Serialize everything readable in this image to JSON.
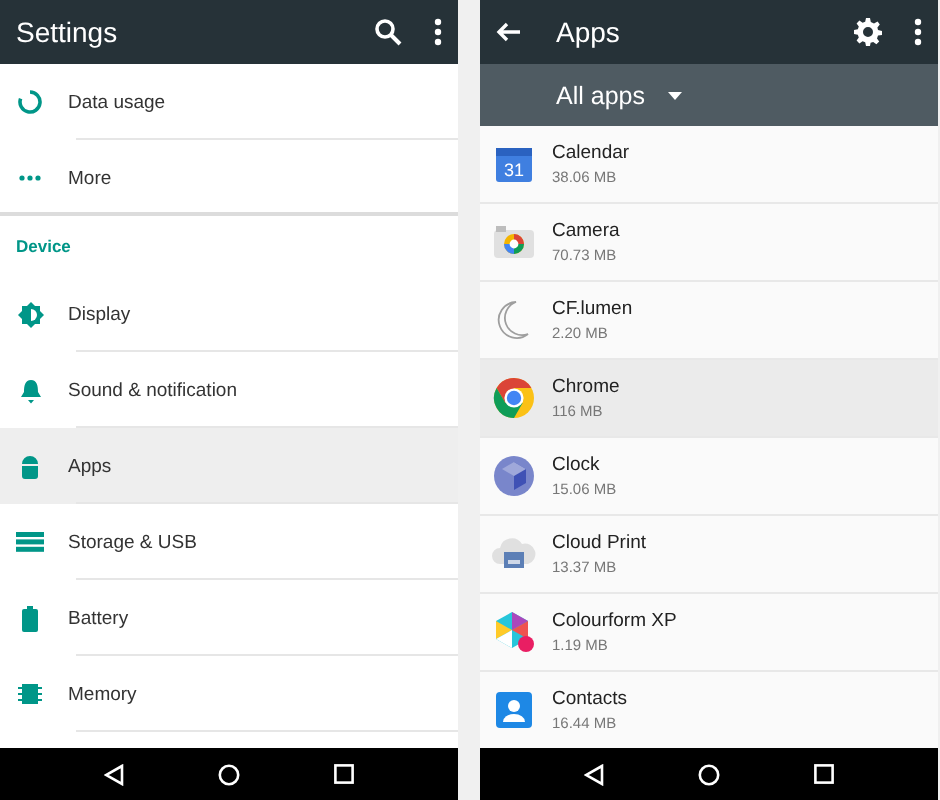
{
  "settings_screen": {
    "title": "Settings",
    "items": [
      {
        "kind": "item",
        "label": "Data usage",
        "selected": false
      },
      {
        "kind": "item",
        "label": "More",
        "selected": false
      },
      {
        "kind": "header",
        "label": "Device"
      },
      {
        "kind": "item",
        "label": "Display",
        "selected": false
      },
      {
        "kind": "item",
        "label": "Sound & notification",
        "selected": false
      },
      {
        "kind": "item",
        "label": "Apps",
        "selected": true
      },
      {
        "kind": "item",
        "label": "Storage & USB",
        "selected": false
      },
      {
        "kind": "item",
        "label": "Battery",
        "selected": false
      },
      {
        "kind": "item",
        "label": "Memory",
        "selected": false
      }
    ]
  },
  "apps_screen": {
    "title": "Apps",
    "filter": "All apps",
    "apps": [
      {
        "icon_text": "31",
        "name": "Calendar",
        "size": "38.06 MB",
        "selected": false
      },
      {
        "name": "Camera",
        "size": "70.73 MB",
        "selected": false
      },
      {
        "name": "CF.lumen",
        "size": "2.20 MB",
        "selected": false
      },
      {
        "name": "Chrome",
        "size": "116 MB",
        "selected": true
      },
      {
        "name": "Clock",
        "size": "15.06 MB",
        "selected": false
      },
      {
        "name": "Cloud Print",
        "size": "13.37 MB",
        "selected": false
      },
      {
        "name": "Colourform XP",
        "size": "1.19 MB",
        "selected": false
      },
      {
        "name": "Contacts",
        "size": "16.44 MB",
        "selected": false
      }
    ]
  }
}
